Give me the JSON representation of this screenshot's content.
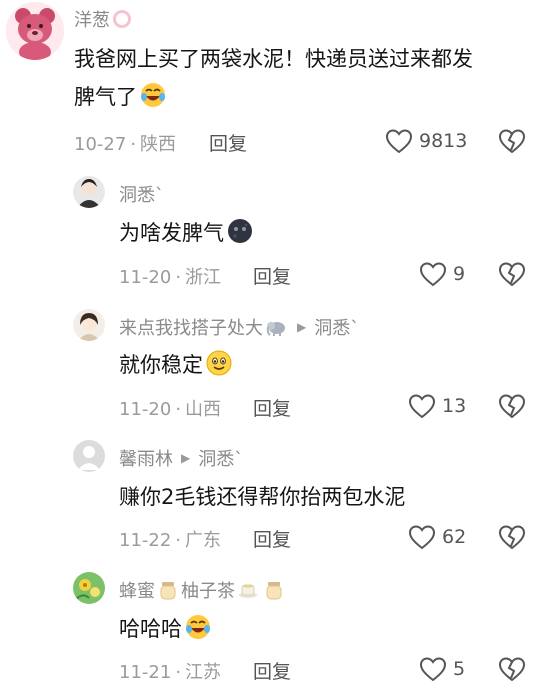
{
  "comments": [
    {
      "username": "洋葱",
      "username_badge_icon": "pink-ring-icon",
      "avatar_icon": "pink-bear-avatar",
      "text_line1": "我爸网上买了两袋水泥！快递员送过来都发",
      "text_line2": "脾气了",
      "text_emoji": "laugh-cry-emoji",
      "date": "10-27",
      "location": "陕西",
      "reply_label": "回复",
      "likes": "9813"
    },
    {
      "username": "洞悉`",
      "avatar_icon": "cartoon-man-avatar",
      "text": "为啥发脾气",
      "text_emoji": "dark-moon-emoji",
      "date": "11-20",
      "location": "浙江",
      "reply_label": "回复",
      "likes": "9"
    },
    {
      "username": "来点我找搭子处大",
      "username_emoji": "elephant-emoji",
      "reply_to": "洞悉`",
      "avatar_icon": "cartoon-girl-avatar",
      "text": "就你稳定",
      "text_emoji": "smile-emoji",
      "date": "11-20",
      "location": "山西",
      "reply_label": "回复",
      "likes": "13"
    },
    {
      "username": "馨雨林",
      "reply_to": "洞悉`",
      "avatar_icon": "default-user-avatar",
      "text": "赚你2毛钱还得帮你抬两包水泥",
      "date": "11-22",
      "location": "广东",
      "reply_label": "回复",
      "likes": "62"
    },
    {
      "username_part1": "蜂蜜",
      "username_part2": "柚子茶",
      "username_emojis": [
        "honey-jar-emoji",
        "tea-cup-emoji",
        "honey-jar-emoji"
      ],
      "avatar_icon": "yellow-flower-avatar",
      "text": "哈哈哈",
      "text_emoji": "laugh-cry-emoji",
      "date": "11-21",
      "location": "江苏",
      "reply_label": "回复",
      "likes": "5"
    }
  ],
  "separator": "·",
  "reply_arrow": "▶",
  "colors": {
    "meta_gray": "#9b9b9b",
    "name_gray": "#8a8a8a",
    "text_black": "#161616",
    "icon_gray": "#555555"
  }
}
